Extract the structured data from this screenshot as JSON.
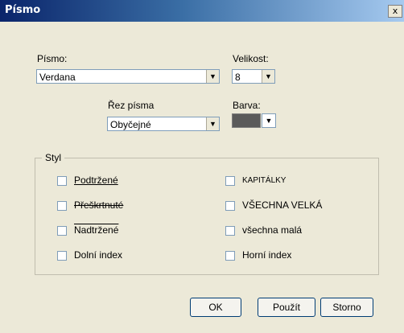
{
  "window": {
    "title": "Písmo",
    "close_label": "x"
  },
  "font": {
    "label": "Písmo:",
    "value": "Verdana"
  },
  "size": {
    "label": "Velikost:",
    "value": "8"
  },
  "style_cut": {
    "label": "Řez písma",
    "value": "Obyčejné"
  },
  "color": {
    "label": "Barva:",
    "value": "#5a5a5a"
  },
  "group": {
    "legend": "Styl",
    "options": [
      {
        "label": "Podtržené",
        "checked": false,
        "decoration": "underline"
      },
      {
        "label": "Přeškrtnuté",
        "checked": false,
        "decoration": "line-through"
      },
      {
        "label": "Nadtržené",
        "checked": false,
        "decoration": "overline"
      },
      {
        "label": "Dolní index",
        "checked": false,
        "decoration": "none"
      },
      {
        "label": "KAPITÁLKY",
        "checked": false,
        "decoration": "small-caps"
      },
      {
        "label": "VŠECHNA VELKÁ",
        "checked": false,
        "decoration": "none"
      },
      {
        "label": "všechna malá",
        "checked": false,
        "decoration": "none"
      },
      {
        "label": "Horní index",
        "checked": false,
        "decoration": "none"
      }
    ]
  },
  "buttons": {
    "ok": "OK",
    "apply": "Použít",
    "cancel": "Storno"
  }
}
